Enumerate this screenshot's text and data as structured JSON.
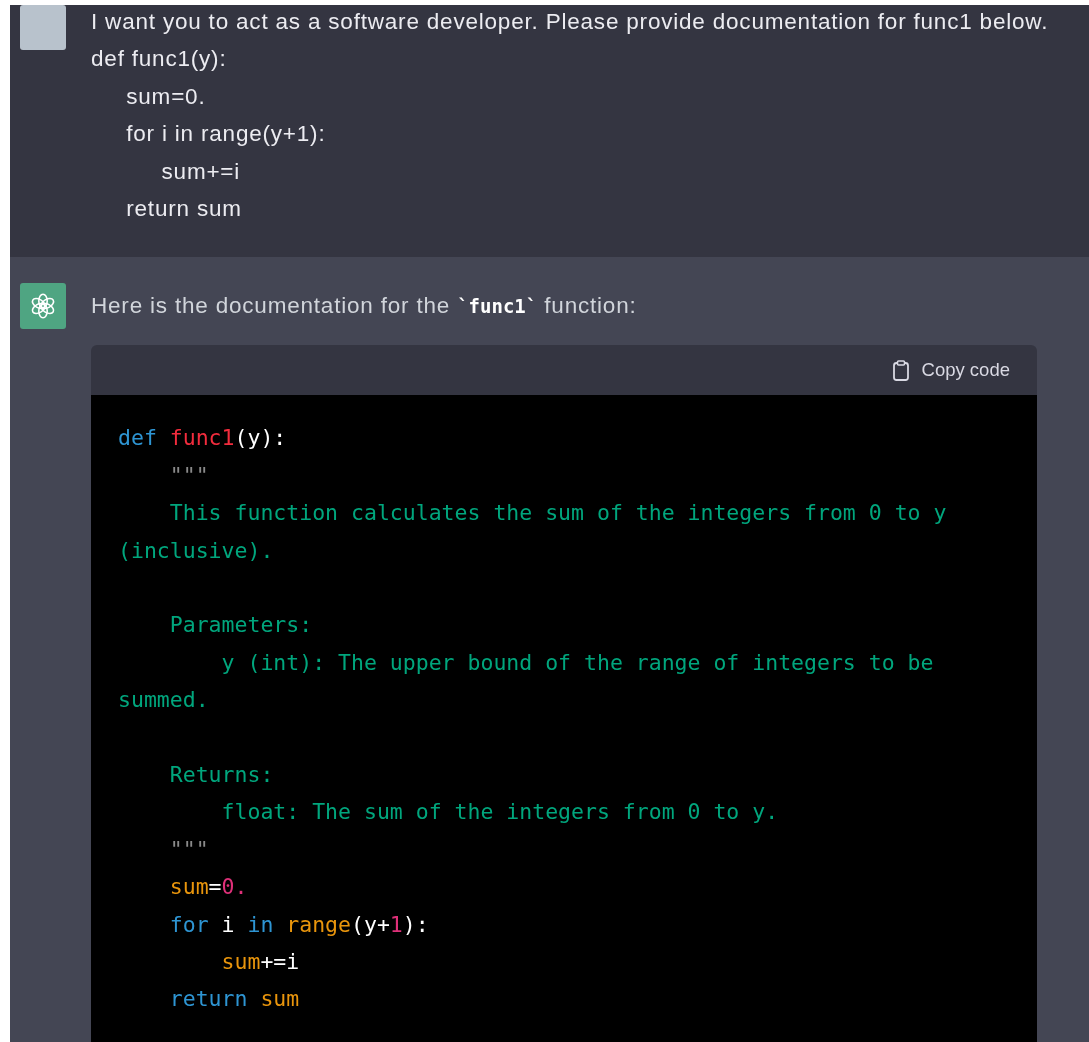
{
  "messages": [
    {
      "kind": "user",
      "lines": [
        "I want you to act as a software developer. Please provide documentation for func1 below.",
        "def func1(y):",
        "     sum=0.",
        "     for i in range(y+1):",
        "          sum+=i",
        "     return sum"
      ]
    },
    {
      "kind": "assistant",
      "text": "Here is the documentation for the **`func1`** function:",
      "code_block": {
        "copy_button": "Copy code",
        "lines": [
          {
            "kind": "code",
            "tokens": [
              {
                "kind": "keyword",
                "text": "def"
              },
              {
                "kind": "function",
                "text": " func1"
              },
              {
                "kind": "plain",
                "text": "(y):"
              }
            ]
          },
          {
            "kind": "code",
            "tokens": [
              {
                "kind": "quote",
                "text": "    \"\"\""
              }
            ]
          },
          {
            "kind": "code",
            "tokens": [
              {
                "kind": "string",
                "text": "    This function calculates the sum of the integers from 0 to y"
              }
            ]
          },
          {
            "kind": "code",
            "tokens": [
              {
                "kind": "string",
                "text": "(inclusive)."
              }
            ]
          },
          {
            "kind": "blank"
          },
          {
            "kind": "code",
            "tokens": [
              {
                "kind": "string",
                "text": "    Parameters:"
              }
            ]
          },
          {
            "kind": "code",
            "tokens": [
              {
                "kind": "string",
                "text": "        y (int): The upper bound of the range of integers to be"
              }
            ]
          },
          {
            "kind": "code",
            "tokens": [
              {
                "kind": "string",
                "text": "summed."
              }
            ]
          },
          {
            "kind": "blank"
          },
          {
            "kind": "code",
            "tokens": [
              {
                "kind": "string",
                "text": "    Returns:"
              }
            ]
          },
          {
            "kind": "code",
            "tokens": [
              {
                "kind": "string",
                "text": "        float: The sum of the integers from 0 to y."
              }
            ]
          },
          {
            "kind": "code",
            "tokens": [
              {
                "kind": "quote",
                "text": "    \"\"\""
              }
            ]
          },
          {
            "kind": "code",
            "tokens": [
              {
                "kind": "variable",
                "text": "    sum"
              },
              {
                "kind": "plain",
                "text": "="
              },
              {
                "kind": "number",
                "text": "0."
              }
            ]
          },
          {
            "kind": "code",
            "tokens": [
              {
                "kind": "keyword",
                "text": "    for"
              },
              {
                "kind": "plain",
                "text": " i "
              },
              {
                "kind": "keyword",
                "text": "in"
              },
              {
                "kind": "variable",
                "text": " range"
              },
              {
                "kind": "plain",
                "text": "(y+"
              },
              {
                "kind": "number",
                "text": "1"
              },
              {
                "kind": "plain",
                "text": "):"
              }
            ]
          },
          {
            "kind": "code",
            "tokens": [
              {
                "kind": "variable",
                "text": "        sum"
              },
              {
                "kind": "plain",
                "text": "+=i"
              }
            ]
          },
          {
            "kind": "code",
            "tokens": [
              {
                "kind": "keyword",
                "text": "    return"
              },
              {
                "kind": "variable",
                "text": " sum"
              }
            ]
          }
        ]
      }
    }
  ]
}
